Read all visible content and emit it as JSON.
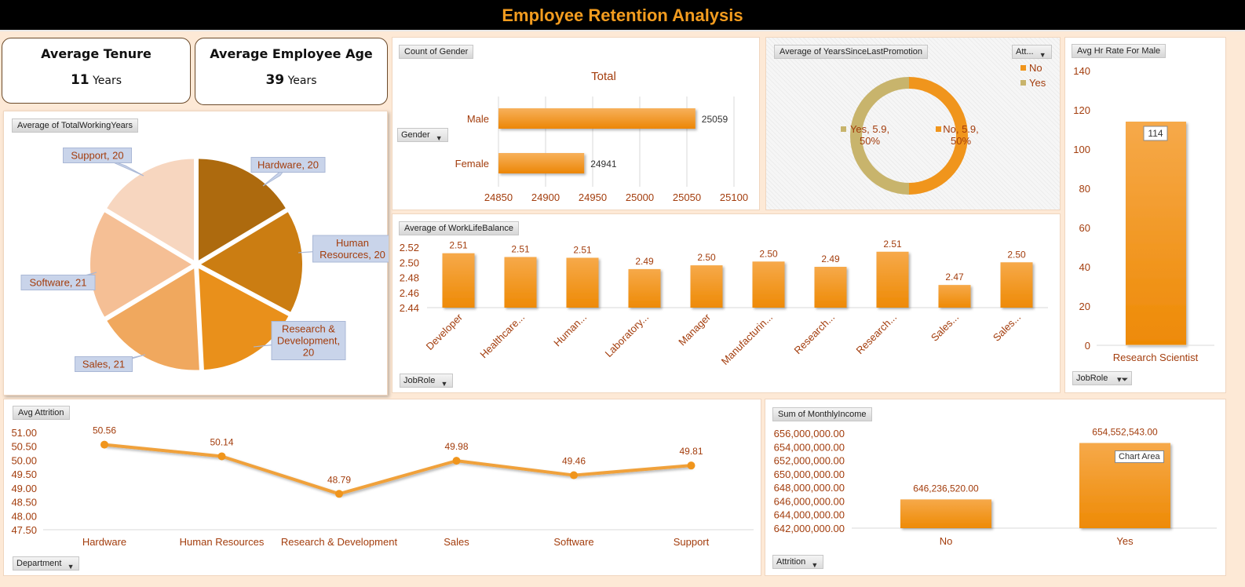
{
  "header": {
    "title": "Employee Retention Analysis"
  },
  "kpis": {
    "tenure": {
      "title": "Average Tenure",
      "value": "11",
      "unit": "Years"
    },
    "age": {
      "title": "Average Employee Age",
      "value": "39",
      "unit": "Years"
    }
  },
  "colors": {
    "accent": "#f39c1f",
    "label": "#a33d0d",
    "header_bg": "#000000",
    "page_bg": "#fde9d6"
  },
  "field_buttons": {
    "pie": "Average of TotalWorkingYears",
    "gender": "Count of Gender",
    "promotion": "Average of YearsSinceLastPromotion",
    "hr": "Avg Hr Rate For Male",
    "wlb": "Average of WorkLifeBalance",
    "attrition": "Avg Attrition",
    "income": "Sum of MonthlyIncome"
  },
  "dropdowns": {
    "gender": "Gender",
    "promotion": "Att...",
    "jobrole": "JobRole",
    "hr_jobrole": "JobRole",
    "department": "Department",
    "income_attrition": "Attrition"
  },
  "tooltip": "Chart Area",
  "chart_data": [
    {
      "id": "total_working_years",
      "type": "pie",
      "categories": [
        "Hardware",
        "Human Resources",
        "Research & Development",
        "Sales",
        "Software",
        "Support"
      ],
      "values": [
        20,
        20,
        20,
        21,
        21,
        20
      ],
      "labels": [
        "Hardware, 20",
        "Human Resources, 20",
        "Research & Development, 20",
        "Sales, 21",
        "Software, 21",
        "Support, 20"
      ],
      "colors": [
        "#ad6a0e",
        "#cb7d12",
        "#e9901b",
        "#f0a85e",
        "#f5bf95",
        "#f7d6bf"
      ]
    },
    {
      "id": "count_of_gender",
      "type": "bar",
      "orientation": "horizontal",
      "title": "Total",
      "categories": [
        "Male",
        "Female"
      ],
      "values": [
        25059,
        24941
      ],
      "xlim": [
        24850,
        25100
      ],
      "xticks": [
        "24850",
        "24900",
        "24950",
        "25000",
        "25050",
        "25100"
      ]
    },
    {
      "id": "years_since_last_promotion",
      "type": "pie",
      "donut": true,
      "categories": [
        "No",
        "Yes"
      ],
      "values": [
        5.9,
        5.9
      ],
      "legend": [
        "No",
        "Yes"
      ],
      "legend_position": "top-right",
      "labels": [
        "No, 5.9, 50%",
        "Yes, 5.9, 50%"
      ],
      "colors": [
        "#f0951c",
        "#c8b46c"
      ]
    },
    {
      "id": "avg_hr_rate_male",
      "type": "bar",
      "categories": [
        "Research Scientist"
      ],
      "values": [
        114
      ],
      "ylim": [
        0,
        140
      ],
      "yticks": [
        "0",
        "20",
        "40",
        "60",
        "80",
        "100",
        "120",
        "140"
      ]
    },
    {
      "id": "work_life_balance",
      "type": "bar",
      "categories": [
        "Developer",
        "Healthcare...",
        "Human...",
        "Laboratory...",
        "Manager",
        "Manufacturin...",
        "Research...",
        "Research...",
        "Sales...",
        "Sales..."
      ],
      "values": [
        2.51,
        2.51,
        2.51,
        2.49,
        2.5,
        2.5,
        2.49,
        2.51,
        2.47,
        2.5
      ],
      "plot_values": [
        2.512,
        2.507,
        2.506,
        2.491,
        2.496,
        2.501,
        2.494,
        2.514,
        2.47,
        2.5
      ],
      "data_labels": [
        "2.51",
        "2.51",
        "2.51",
        "2.49",
        "2.50",
        "2.50",
        "2.49",
        "2.51",
        "2.47",
        "2.50"
      ],
      "ylim": [
        2.44,
        2.52
      ],
      "yticks": [
        "2.44",
        "2.46",
        "2.48",
        "2.50",
        "2.52"
      ]
    },
    {
      "id": "avg_attrition",
      "type": "line",
      "categories": [
        "Hardware",
        "Human Resources",
        "Research & Development",
        "Sales",
        "Software",
        "Support"
      ],
      "values": [
        50.56,
        50.14,
        48.79,
        49.98,
        49.46,
        49.81
      ],
      "data_labels": [
        "50.56",
        "50.14",
        "48.79",
        "49.98",
        "49.46",
        "49.81"
      ],
      "ylim": [
        47.5,
        51.0
      ],
      "yticks": [
        "47.50",
        "48.00",
        "48.50",
        "49.00",
        "49.50",
        "50.00",
        "50.50",
        "51.00"
      ]
    },
    {
      "id": "sum_monthly_income",
      "type": "bar",
      "categories": [
        "No",
        "Yes"
      ],
      "values": [
        646236520,
        654552543
      ],
      "data_labels": [
        "646,236,520.00",
        "654,552,543.00"
      ],
      "ylim": [
        642000000,
        656000000
      ],
      "yticks": [
        "642,000,000.00",
        "644,000,000.00",
        "646,000,000.00",
        "648,000,000.00",
        "650,000,000.00",
        "652,000,000.00",
        "654,000,000.00",
        "656,000,000.00"
      ]
    }
  ]
}
